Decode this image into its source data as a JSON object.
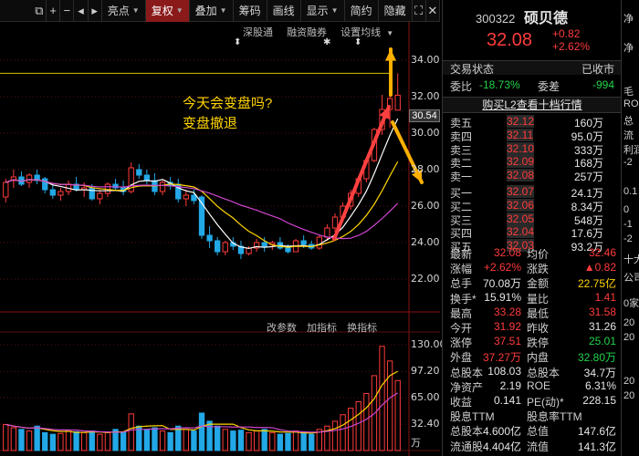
{
  "toolbar": {
    "buttons": [
      {
        "label": "亮点",
        "dropdown": true
      },
      {
        "label": "复权",
        "dropdown": true,
        "active": true
      },
      {
        "label": "叠加",
        "dropdown": true
      },
      {
        "label": "筹码",
        "dropdown": false
      },
      {
        "label": "画线",
        "dropdown": false
      },
      {
        "label": "显示",
        "dropdown": true
      },
      {
        "label": "简约",
        "dropdown": false
      },
      {
        "label": "隐藏",
        "dropdown": false
      }
    ],
    "icons": [
      "restore-window-icon",
      "plus-icon",
      "minus-icon",
      "pan-left-icon",
      "pan-right-icon",
      "fullscreen-icon",
      "close-icon"
    ]
  },
  "chart": {
    "top_links": [
      "深股通",
      "融资融券",
      "设置均线"
    ],
    "annotation": [
      "今天会变盘吗?",
      "变盘撤退"
    ],
    "price_tag": "30.54",
    "price_axis": [
      "34.00",
      "32.00",
      "30.00",
      "28.00",
      "26.00",
      "24.00",
      "22.00"
    ],
    "indicator_links": [
      "改参数",
      "加指标",
      "换指标"
    ],
    "volume_axis": [
      "130.00",
      "97.20",
      "65.00",
      "32.40",
      "万"
    ],
    "colors": {
      "up": "#ff3b3b",
      "down": "#22a8e6",
      "ma5": "#ffffff",
      "ma10": "#ffd400",
      "ma20": "#d046d0",
      "arrow_yellow": "#ffb000",
      "arrow_red": "#ff4040"
    }
  },
  "chart_data": {
    "type": "candlestick",
    "candles": [
      [
        26.5,
        27.5,
        26.2,
        27.3
      ],
      [
        27.4,
        28.0,
        27.0,
        27.6
      ],
      [
        27.6,
        27.9,
        27.1,
        27.2
      ],
      [
        27.3,
        27.8,
        27.0,
        27.7
      ],
      [
        27.7,
        28.0,
        27.2,
        27.4
      ],
      [
        27.5,
        27.6,
        26.7,
        26.9
      ],
      [
        26.9,
        27.2,
        26.4,
        26.6
      ],
      [
        26.6,
        27.0,
        26.3,
        26.8
      ],
      [
        26.8,
        27.4,
        26.6,
        27.2
      ],
      [
        27.2,
        27.6,
        26.8,
        26.9
      ],
      [
        26.9,
        27.3,
        26.5,
        27.0
      ],
      [
        27.0,
        27.2,
        26.3,
        26.4
      ],
      [
        26.4,
        26.9,
        26.1,
        26.7
      ],
      [
        26.7,
        27.3,
        26.5,
        27.2
      ],
      [
        27.2,
        27.5,
        26.9,
        27.0
      ],
      [
        27.0,
        27.4,
        26.6,
        26.8
      ],
      [
        26.8,
        28.4,
        26.7,
        28.1
      ],
      [
        28.0,
        28.3,
        27.5,
        27.7
      ],
      [
        27.7,
        28.0,
        27.2,
        27.4
      ],
      [
        27.4,
        27.8,
        26.6,
        26.8
      ],
      [
        26.8,
        27.4,
        26.6,
        27.3
      ],
      [
        27.3,
        27.6,
        26.9,
        27.1
      ],
      [
        27.2,
        27.5,
        26.2,
        26.4
      ],
      [
        26.4,
        26.9,
        26.0,
        26.6
      ],
      [
        26.6,
        26.9,
        26.1,
        26.3
      ],
      [
        26.5,
        26.6,
        24.2,
        24.4
      ],
      [
        24.4,
        24.9,
        23.7,
        24.1
      ],
      [
        24.1,
        24.3,
        23.3,
        23.5
      ],
      [
        23.5,
        24.1,
        23.3,
        24.0
      ],
      [
        24.0,
        24.3,
        23.6,
        23.8
      ],
      [
        23.8,
        24.1,
        23.1,
        23.4
      ],
      [
        23.4,
        23.8,
        23.3,
        23.7
      ],
      [
        23.7,
        24.2,
        23.5,
        24.0
      ],
      [
        24.0,
        24.3,
        23.5,
        23.8
      ],
      [
        23.9,
        24.1,
        23.6,
        24.0
      ],
      [
        24.0,
        24.3,
        23.6,
        23.7
      ],
      [
        23.7,
        23.9,
        23.4,
        23.5
      ],
      [
        23.5,
        24.2,
        23.5,
        24.1
      ],
      [
        24.1,
        24.4,
        23.7,
        23.9
      ],
      [
        23.9,
        24.1,
        23.6,
        23.7
      ],
      [
        23.7,
        24.4,
        23.6,
        24.3
      ],
      [
        24.3,
        25.0,
        24.1,
        24.8
      ],
      [
        24.8,
        25.6,
        24.6,
        25.4
      ],
      [
        25.4,
        26.2,
        25.2,
        26.0
      ],
      [
        26.0,
        26.9,
        25.8,
        26.7
      ],
      [
        26.7,
        27.6,
        26.5,
        27.5
      ],
      [
        27.5,
        28.6,
        27.3,
        28.5
      ],
      [
        28.5,
        30.3,
        28.4,
        30.2
      ],
      [
        30.2,
        32.1,
        29.9,
        31.3
      ],
      [
        31.3,
        32.5,
        30.3,
        31.9
      ],
      [
        31.26,
        33.28,
        31.58,
        32.08
      ]
    ],
    "volumes": [
      32,
      28,
      26,
      24,
      30,
      22,
      20,
      21,
      25,
      23,
      22,
      24,
      20,
      22,
      26,
      23,
      45,
      30,
      26,
      28,
      24,
      22,
      30,
      26,
      24,
      46,
      36,
      30,
      26,
      24,
      25,
      22,
      24,
      26,
      22,
      20,
      21,
      24,
      22,
      20,
      26,
      30,
      36,
      44,
      52,
      60,
      70,
      92,
      128,
      110,
      86
    ],
    "price_ylim": [
      21.0,
      34.8
    ],
    "volume_ylim": [
      0,
      130
    ]
  },
  "quote": {
    "code": "300322",
    "name": "硕贝德",
    "price": "32.08",
    "change": "+0.82",
    "change_pct": "+2.62%",
    "status_label": "交易状态",
    "status_value": "已收市",
    "webi_label": "委比",
    "webi_value": "-18.73%",
    "wecha_label": "委差",
    "wecha_value": "-994",
    "l2_link": "购买L2查看十档行情",
    "asks": [
      {
        "label": "卖五",
        "price": "32.12",
        "vol": "160万"
      },
      {
        "label": "卖四",
        "price": "32.11",
        "vol": "95.0万"
      },
      {
        "label": "卖三",
        "price": "32.10",
        "vol": "333万"
      },
      {
        "label": "卖二",
        "price": "32.09",
        "vol": "168万"
      },
      {
        "label": "卖一",
        "price": "32.08",
        "vol": "257万"
      }
    ],
    "bids": [
      {
        "label": "买一",
        "price": "32.07",
        "vol": "24.1万"
      },
      {
        "label": "买二",
        "price": "32.06",
        "vol": "8.34万"
      },
      {
        "label": "买三",
        "price": "32.05",
        "vol": "548万"
      },
      {
        "label": "买四",
        "price": "32.04",
        "vol": "17.6万"
      },
      {
        "label": "买五",
        "price": "32.03",
        "vol": "93.2万"
      }
    ],
    "stats": [
      {
        "l1": "最新",
        "v1": "32.08",
        "c1": "red",
        "l2": "均价",
        "v2": "32.46",
        "c2": "red"
      },
      {
        "l1": "涨幅",
        "v1": "+2.62%",
        "c1": "red",
        "l2": "涨跌",
        "v2": "▲0.82",
        "c2": "red"
      },
      {
        "l1": "总手",
        "v1": "70.08万",
        "c1": "white",
        "l2": "金额",
        "v2": "22.75亿",
        "c2": "yellow"
      },
      {
        "l1": "换手*",
        "v1": "15.91%",
        "c1": "white",
        "l2": "量比",
        "v2": "1.41",
        "c2": "red"
      },
      {
        "l1": "最高",
        "v1": "33.28",
        "c1": "red",
        "l2": "最低",
        "v2": "31.58",
        "c2": "red"
      },
      {
        "l1": "今开",
        "v1": "31.92",
        "c1": "red",
        "l2": "昨收",
        "v2": "31.26",
        "c2": "white"
      },
      {
        "l1": "涨停",
        "v1": "37.51",
        "c1": "red",
        "l2": "跌停",
        "v2": "25.01",
        "c2": "green"
      },
      {
        "l1": "外盘",
        "v1": "37.27万",
        "c1": "red",
        "l2": "内盘",
        "v2": "32.80万",
        "c2": "green"
      },
      {
        "l1": "总股本",
        "v1": "108.03",
        "c1": "white",
        "l2": "总股本",
        "v2": "34.7万",
        "c2": "white"
      },
      {
        "l1": "净资产",
        "v1": "2.19",
        "c1": "white",
        "l2": "ROE",
        "v2": "6.31%",
        "c2": "white"
      },
      {
        "l1": "收益",
        "v1": "0.141",
        "c1": "white",
        "l2": "PE(动)*",
        "v2": "228.15",
        "c2": "white"
      },
      {
        "l1": "股息TTM",
        "v1": "",
        "c1": "white",
        "l2": "股息率TTM",
        "v2": "",
        "c2": "white"
      },
      {
        "l1": "总股本",
        "v1": "4.600亿",
        "c1": "white",
        "l2": "总值",
        "v2": "147.6亿",
        "c2": "white"
      },
      {
        "l1": "流通股",
        "v1": "4.404亿",
        "c1": "white",
        "l2": "流值",
        "v2": "141.3亿",
        "c2": "white"
      }
    ]
  },
  "right_strip": [
    "净",
    "净",
    "毛",
    "RO",
    "总",
    "流",
    "利润",
    "-2",
    "0.1",
    "0",
    "-1",
    "-2",
    "十大",
    "公司",
    "0家",
    "20",
    "20",
    "20",
    "20"
  ]
}
